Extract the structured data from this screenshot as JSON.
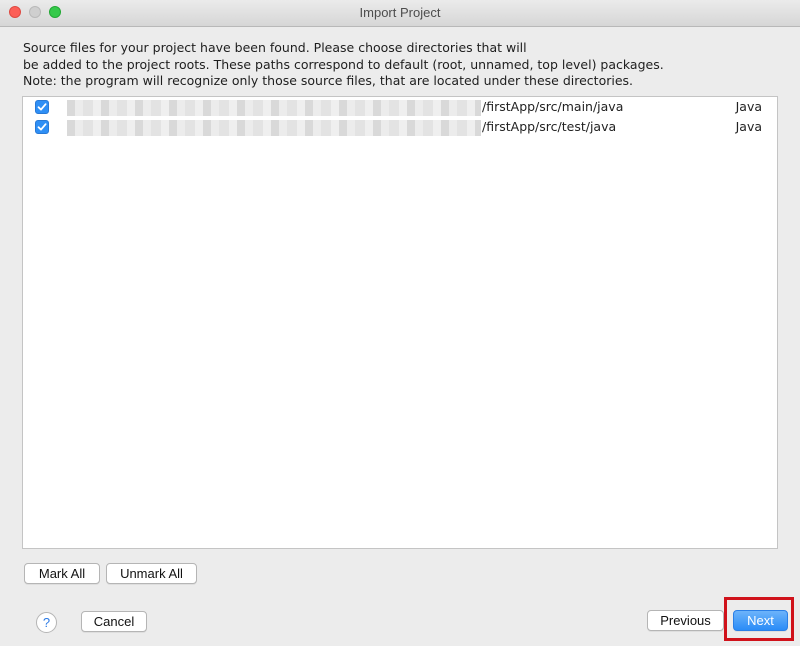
{
  "window": {
    "title": "Import Project"
  },
  "description": {
    "line1": "Source files for your project have been found. Please choose directories that will",
    "line2": "be added to the project roots. These paths correspond to default (root, unnamed, top level) packages.",
    "line3": "Note: the program will recognize only those source files, that are located under these directories."
  },
  "directories": [
    {
      "path": "/firstApp/src/main/java",
      "language": "Java",
      "checked": true
    },
    {
      "path": "/firstApp/src/test/java",
      "language": "Java",
      "checked": true
    }
  ],
  "buttons": {
    "mark_all": "Mark All",
    "unmark_all": "Unmark All",
    "help": "?",
    "cancel": "Cancel",
    "previous": "Previous",
    "next": "Next"
  },
  "colors": {
    "accent": "#2a8cf7",
    "highlight": "#d0121b"
  }
}
